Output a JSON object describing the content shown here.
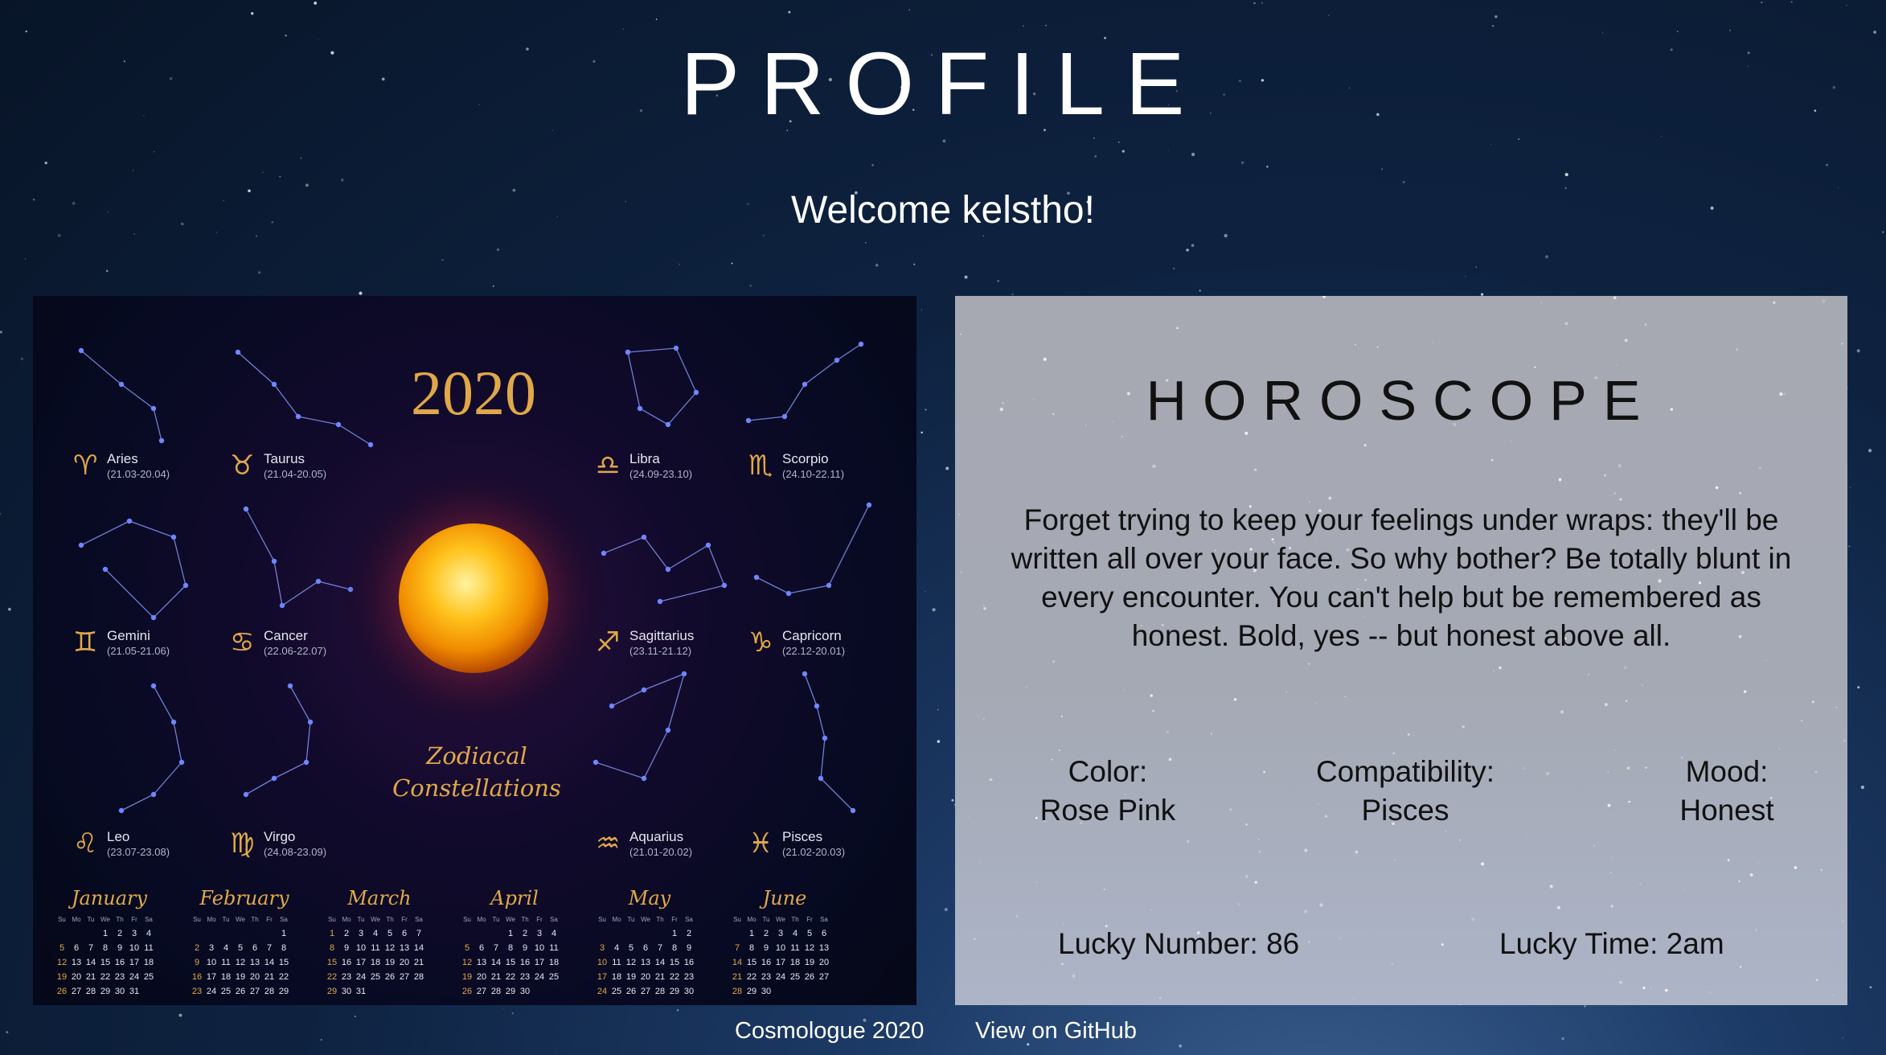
{
  "header": {
    "title": "PROFILE",
    "welcome": "Welcome kelstho!"
  },
  "calendar_image": {
    "year": "2020",
    "caption_line1": "Zodiacal",
    "caption_line2": "Constellations",
    "signs": [
      {
        "name": "Aries",
        "dates": "(21.03-20.04)",
        "glyph": "♈"
      },
      {
        "name": "Taurus",
        "dates": "(21.04-20.05)",
        "glyph": "♉"
      },
      {
        "name": "Libra",
        "dates": "(24.09-23.10)",
        "glyph": "♎"
      },
      {
        "name": "Scorpio",
        "dates": "(24.10-22.11)",
        "glyph": "♏"
      },
      {
        "name": "Gemini",
        "dates": "(21.05-21.06)",
        "glyph": "♊"
      },
      {
        "name": "Cancer",
        "dates": "(22.06-22.07)",
        "glyph": "♋"
      },
      {
        "name": "Sagittarius",
        "dates": "(23.11-21.12)",
        "glyph": "♐"
      },
      {
        "name": "Capricorn",
        "dates": "(22.12-20.01)",
        "glyph": "♑"
      },
      {
        "name": "Leo",
        "dates": "(23.07-23.08)",
        "glyph": "♌"
      },
      {
        "name": "Virgo",
        "dates": "(24.08-23.09)",
        "glyph": "♍"
      },
      {
        "name": "Aquarius",
        "dates": "(21.01-20.02)",
        "glyph": "♒"
      },
      {
        "name": "Pisces",
        "dates": "(21.02-20.03)",
        "glyph": "♓"
      }
    ],
    "weekday_header": [
      "Su",
      "Mo",
      "Tu",
      "We",
      "Th",
      "Fr",
      "Sa"
    ],
    "months": [
      {
        "name": "January",
        "rows": [
          [
            "",
            "",
            "",
            "1",
            "2",
            "3",
            "4"
          ],
          [
            "5",
            "6",
            "7",
            "8",
            "9",
            "10",
            "11"
          ],
          [
            "12",
            "13",
            "14",
            "15",
            "16",
            "17",
            "18"
          ],
          [
            "19",
            "20",
            "21",
            "22",
            "23",
            "24",
            "25"
          ],
          [
            "26",
            "27",
            "28",
            "29",
            "30",
            "31",
            ""
          ]
        ]
      },
      {
        "name": "February",
        "rows": [
          [
            "",
            "",
            "",
            "",
            "",
            "",
            "1"
          ],
          [
            "2",
            "3",
            "4",
            "5",
            "6",
            "7",
            "8"
          ],
          [
            "9",
            "10",
            "11",
            "12",
            "13",
            "14",
            "15"
          ],
          [
            "16",
            "17",
            "18",
            "19",
            "20",
            "21",
            "22"
          ],
          [
            "23",
            "24",
            "25",
            "26",
            "27",
            "28",
            "29"
          ]
        ]
      },
      {
        "name": "March",
        "rows": [
          [
            "1",
            "2",
            "3",
            "4",
            "5",
            "6",
            "7"
          ],
          [
            "8",
            "9",
            "10",
            "11",
            "12",
            "13",
            "14"
          ],
          [
            "15",
            "16",
            "17",
            "18",
            "19",
            "20",
            "21"
          ],
          [
            "22",
            "23",
            "24",
            "25",
            "26",
            "27",
            "28"
          ],
          [
            "29",
            "30",
            "31",
            "",
            "",
            "",
            ""
          ]
        ]
      },
      {
        "name": "April",
        "rows": [
          [
            "",
            "",
            "",
            "1",
            "2",
            "3",
            "4"
          ],
          [
            "5",
            "6",
            "7",
            "8",
            "9",
            "10",
            "11"
          ],
          [
            "12",
            "13",
            "14",
            "15",
            "16",
            "17",
            "18"
          ],
          [
            "19",
            "20",
            "21",
            "22",
            "23",
            "24",
            "25"
          ],
          [
            "26",
            "27",
            "28",
            "29",
            "30",
            "",
            ""
          ]
        ]
      },
      {
        "name": "May",
        "rows": [
          [
            "",
            "",
            "",
            "",
            "",
            "1",
            "2"
          ],
          [
            "3",
            "4",
            "5",
            "6",
            "7",
            "8",
            "9"
          ],
          [
            "10",
            "11",
            "12",
            "13",
            "14",
            "15",
            "16"
          ],
          [
            "17",
            "18",
            "19",
            "20",
            "21",
            "22",
            "23"
          ],
          [
            "24",
            "25",
            "26",
            "27",
            "28",
            "29",
            "30"
          ]
        ]
      },
      {
        "name": "June",
        "rows": [
          [
            "",
            "1",
            "2",
            "3",
            "4",
            "5",
            "6"
          ],
          [
            "7",
            "8",
            "9",
            "10",
            "11",
            "12",
            "13"
          ],
          [
            "14",
            "15",
            "16",
            "17",
            "18",
            "19",
            "20"
          ],
          [
            "21",
            "22",
            "23",
            "24",
            "25",
            "26",
            "27"
          ],
          [
            "28",
            "29",
            "30",
            "",
            "",
            "",
            ""
          ]
        ]
      }
    ]
  },
  "horoscope": {
    "title": "HOROSCOPE",
    "description": "Forget trying to keep your feelings under wraps: they'll be written all over your face. So why bother? Be totally blunt in every encounter. You can't help but be remembered as honest. Bold, yes -- but honest above all.",
    "color_label": "Color:",
    "color_value": "Rose Pink",
    "compat_label": "Compatibility:",
    "compat_value": "Pisces",
    "mood_label": "Mood:",
    "mood_value": "Honest",
    "lucky_number": "Lucky Number: 86",
    "lucky_time": "Lucky Time: 2am"
  },
  "footer": {
    "brand": "Cosmologue 2020",
    "github": "View on GitHub"
  },
  "colors": {
    "gold": "#e0a84a",
    "constellation": "#6f86ff",
    "panel": "#a6a9b2"
  }
}
